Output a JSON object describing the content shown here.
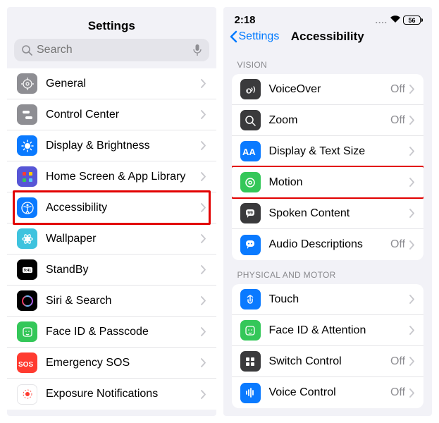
{
  "screen1": {
    "title": "Settings",
    "search_placeholder": "Search",
    "items": [
      {
        "label": "General",
        "icon": "gear",
        "bg": "#8e8e93"
      },
      {
        "label": "Control Center",
        "icon": "switches",
        "bg": "#8e8e93"
      },
      {
        "label": "Display & Brightness",
        "icon": "sun",
        "bg": "#0a7aff"
      },
      {
        "label": "Home Screen & App Library",
        "icon": "grid",
        "bg": "#5756d6"
      },
      {
        "label": "Accessibility",
        "icon": "access",
        "bg": "#0a7aff",
        "highlight": true
      },
      {
        "label": "Wallpaper",
        "icon": "flower",
        "bg": "#3ec3de"
      },
      {
        "label": "StandBy",
        "icon": "standby",
        "bg": "#000"
      },
      {
        "label": "Siri & Search",
        "icon": "siri",
        "bg": "#000"
      },
      {
        "label": "Face ID & Passcode",
        "icon": "face",
        "bg": "#34c759"
      },
      {
        "label": "Emergency SOS",
        "icon": "sos",
        "bg": "#ff3b30"
      },
      {
        "label": "Exposure Notifications",
        "icon": "expo",
        "bg": "#fff"
      }
    ]
  },
  "screen2": {
    "time": "2:18",
    "battery": "56",
    "back": "Settings",
    "title": "Accessibility",
    "sections": [
      {
        "header": "VISION",
        "rows": [
          {
            "label": "VoiceOver",
            "val": "Off",
            "icon": "voiceover",
            "bg": "#3a3a3c"
          },
          {
            "label": "Zoom",
            "val": "Off",
            "icon": "zoom",
            "bg": "#3a3a3c"
          },
          {
            "label": "Display & Text Size",
            "icon": "aa",
            "bg": "#0a7aff"
          },
          {
            "label": "Motion",
            "icon": "motion",
            "bg": "#34c759",
            "highlight": true
          },
          {
            "label": "Spoken Content",
            "icon": "speak",
            "bg": "#3a3a3c"
          },
          {
            "label": "Audio Descriptions",
            "val": "Off",
            "icon": "bubble",
            "bg": "#0a7aff"
          }
        ]
      },
      {
        "header": "PHYSICAL AND MOTOR",
        "rows": [
          {
            "label": "Touch",
            "icon": "touch",
            "bg": "#0a7aff"
          },
          {
            "label": "Face ID & Attention",
            "icon": "face2",
            "bg": "#34c759"
          },
          {
            "label": "Switch Control",
            "val": "Off",
            "icon": "switch",
            "bg": "#3a3a3c"
          },
          {
            "label": "Voice Control",
            "val": "Off",
            "icon": "voice",
            "bg": "#0a7aff"
          }
        ]
      }
    ]
  }
}
